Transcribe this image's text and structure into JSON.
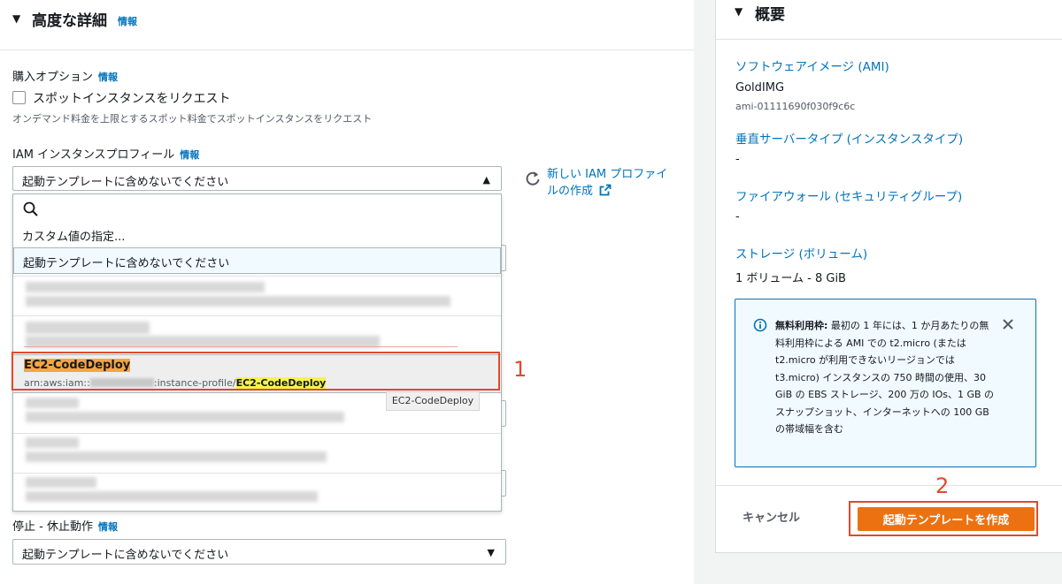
{
  "advanced": {
    "title": "高度な詳細",
    "info": "情報",
    "purchase_label": "購入オプション",
    "purchase_info": "情報",
    "spot_label": "スポットインスタンスをリクエスト",
    "spot_desc": "オンデマンド料金を上限とするスポット料金でスポットインスタンスをリクエスト",
    "iam_label": "IAM インスタンスプロフィール",
    "iam_info": "情報",
    "iam_value": "起動テンプレートに含めないでください",
    "new_profile_line1": "新しい IAM プロファイ",
    "new_profile_line2": "ルの作成",
    "stop_label": "停止 - 休止動作",
    "stop_info": "情報",
    "stop_value": "起動テンプレートに含めないでください"
  },
  "dropdown": {
    "custom": "カスタム値の指定...",
    "selected": "起動テンプレートに含めないでください",
    "highlight_name": "EC2-CodeDeploy",
    "highlight_arn_prefix": "arn:aws:iam::",
    "highlight_arn_mid": ":instance-profile/",
    "highlight_arn_name": "EC2-CodeDeploy",
    "tooltip": "EC2-CodeDeploy"
  },
  "annotations": {
    "one": "1",
    "two": "2"
  },
  "summary": {
    "title": "概要",
    "ami_label": "ソフトウェアイメージ (AMI)",
    "ami_name": "GoldIMG",
    "ami_id": "ami-01111690f030f9c6c",
    "instance_type_label": "垂直サーバータイプ (インスタンスタイプ)",
    "instance_type_value": "-",
    "firewall_label": "ファイアウォール (セキュリティグループ)",
    "firewall_value": "-",
    "storage_label": "ストレージ (ボリューム)",
    "storage_value": "1 ボリューム - 8 GiB",
    "free_tier_bold": "無料利用枠:",
    "free_tier_text": " 最初の 1 年には、1 か月あたりの無料利用枠による AMI での t2.micro (または t2.micro が利用できないリージョンでは t3.micro) インスタンスの 750 時間の使用、30 GiB の EBS ストレージ、200 万の IOs、1 GB のスナップショット、インターネットへの 100 GB の帯域幅を含む",
    "cancel": "キャンセル",
    "create": "起動テンプレートを作成"
  },
  "colors": {
    "accent": "#0073bb",
    "primary_button": "#ec7211",
    "annotation": "#e04a2c"
  }
}
